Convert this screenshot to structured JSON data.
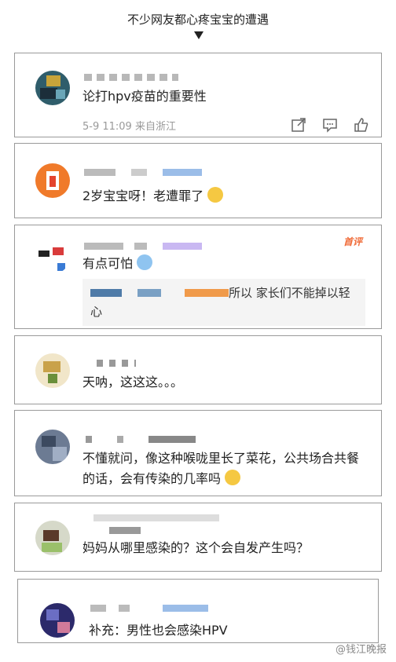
{
  "header": {
    "title": "不少网友都心疼宝宝的遭遇"
  },
  "comments": [
    {
      "text": "论打hpv疫苗的重要性",
      "meta": "5-9 11:09 来自浙江"
    },
    {
      "text": "2岁宝宝呀！老遭罪了"
    },
    {
      "text": "有点可怕",
      "badge": "首评",
      "reply": "所以 家长们不能掉以轻心"
    },
    {
      "text": "天呐，这这这。。。"
    },
    {
      "text": "不懂就问，像这种喉咙里长了菜花，公共场合共餐的话，会有传染的几率吗"
    },
    {
      "text": "妈妈从哪里感染的？这个会自发产生吗？"
    },
    {
      "text": "补充：男性也会感染HPV"
    }
  ],
  "icons": [
    "share-icon",
    "comment-icon",
    "like-icon"
  ],
  "watermark": "@钱江晚报",
  "colors": {
    "border": "#9a9a9a",
    "badge": "#f06b38",
    "reply_bg": "#f4f4f4"
  }
}
